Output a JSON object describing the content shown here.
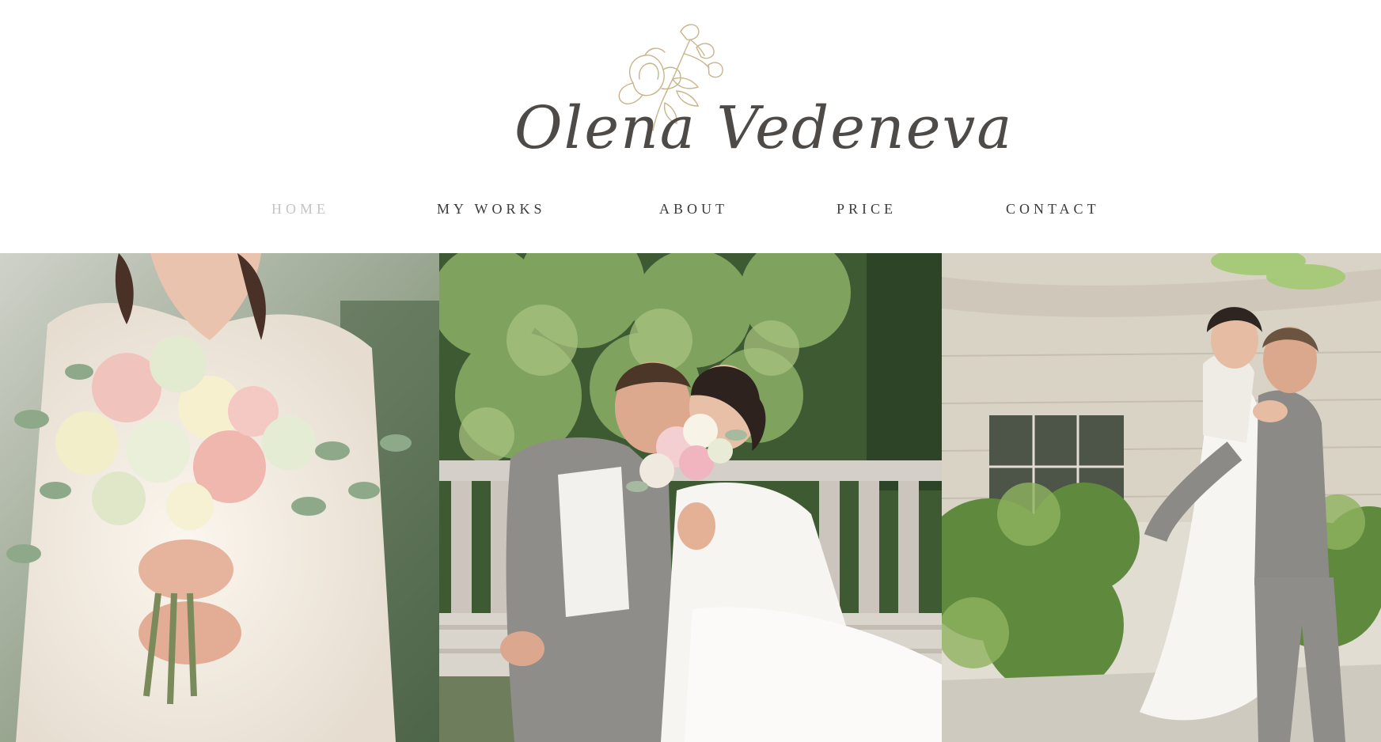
{
  "brand": {
    "logo_text": "Olena Vedeneva"
  },
  "nav": {
    "items": [
      {
        "label": "HOME",
        "active": true
      },
      {
        "label": "MY WORKS",
        "active": false
      },
      {
        "label": "ABOUT",
        "active": false
      },
      {
        "label": "PRICE",
        "active": false
      },
      {
        "label": "CONTACT",
        "active": false
      }
    ]
  },
  "gallery": {
    "photos": [
      {
        "subject": "bride-holding-bouquet"
      },
      {
        "subject": "couple-kissing-on-bench"
      },
      {
        "subject": "groom-lifting-bride"
      }
    ]
  },
  "colors": {
    "text_dark": "#3b3b3b",
    "nav_active": "#c4c4c4",
    "logo_ink": "#4e4a47",
    "logo_floral": "#c9b48a",
    "background": "#ffffff"
  }
}
